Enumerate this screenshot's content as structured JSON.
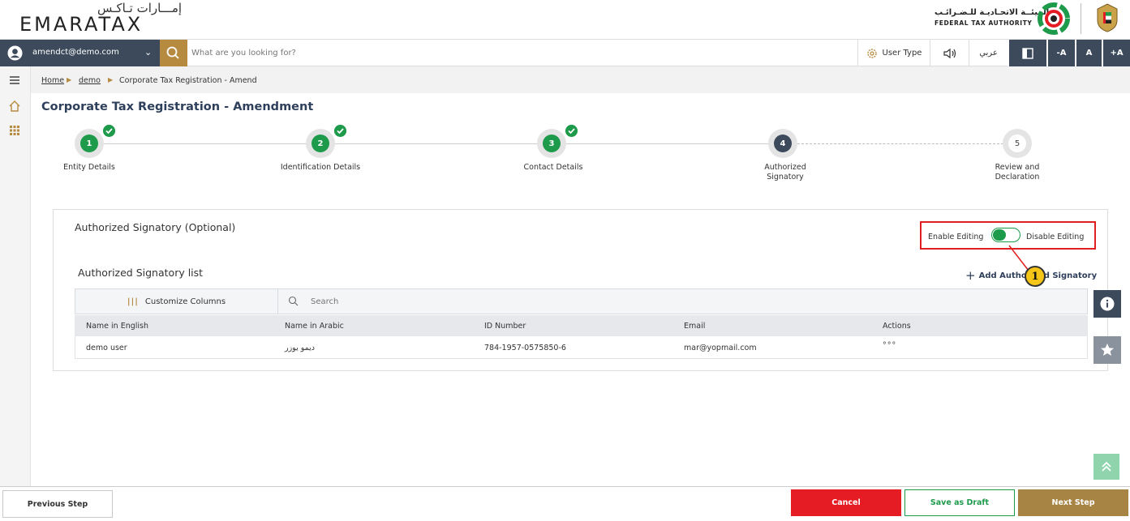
{
  "brand": {
    "logo_arabic": "إمـــارات تـاكـس",
    "logo_english": "EMARATAX",
    "authority_arabic": "الهيئــة الاتحـاديـة للـضـرائـب",
    "authority_english": "FEDERAL TAX AUTHORITY"
  },
  "nav": {
    "user_email": "amendct@demo.com",
    "search_placeholder": "What are you looking for?",
    "user_type_label": "User Type",
    "language_label": "عربي",
    "font_decrease": "-A",
    "font_normal": "A",
    "font_increase": "+A"
  },
  "breadcrumb": {
    "home": "Home",
    "demo": "demo",
    "current": "Corporate Tax Registration - Amend"
  },
  "page": {
    "title": "Corporate Tax Registration - Amendment"
  },
  "stepper": {
    "steps": [
      {
        "number": "1",
        "label_line1": "Entity Details",
        "label_line2": "",
        "status": "done"
      },
      {
        "number": "2",
        "label_line1": "Identification Details",
        "label_line2": "",
        "status": "done"
      },
      {
        "number": "3",
        "label_line1": "Contact Details",
        "label_line2": "",
        "status": "done"
      },
      {
        "number": "4",
        "label_line1": "Authorized",
        "label_line2": "Signatory",
        "status": "current"
      },
      {
        "number": "5",
        "label_line1": "Review and",
        "label_line2": "Declaration",
        "status": "todo"
      }
    ]
  },
  "panel": {
    "title": "Authorized Signatory (Optional)",
    "enable_editing": "Enable Editing",
    "disable_editing": "Disable Editing",
    "list_title": "Authorized Signatory list",
    "add_button": "Add Authorized Signatory",
    "customize_columns": "Customize Columns",
    "table_search_placeholder": "Search",
    "columns": [
      "Name in English",
      "Name in Arabic",
      "ID Number",
      "Email",
      "Actions"
    ],
    "rows": [
      {
        "name_en": "demo user",
        "name_ar": "ديمو يوزر",
        "id_number": "784-1957-0575850-6",
        "email": "mar@yopmail.com",
        "actions": "°°°"
      }
    ]
  },
  "annotation": {
    "badge": "1"
  },
  "footer": {
    "previous": "Previous Step",
    "cancel": "Cancel",
    "save_draft": "Save as Draft",
    "next": "Next Step"
  },
  "colors": {
    "primary_dark": "#3d4a5c",
    "gold": "#b68a3f",
    "success_green": "#1e9a4b",
    "cancel_red": "#e51c23",
    "next_brown": "#a88444"
  }
}
